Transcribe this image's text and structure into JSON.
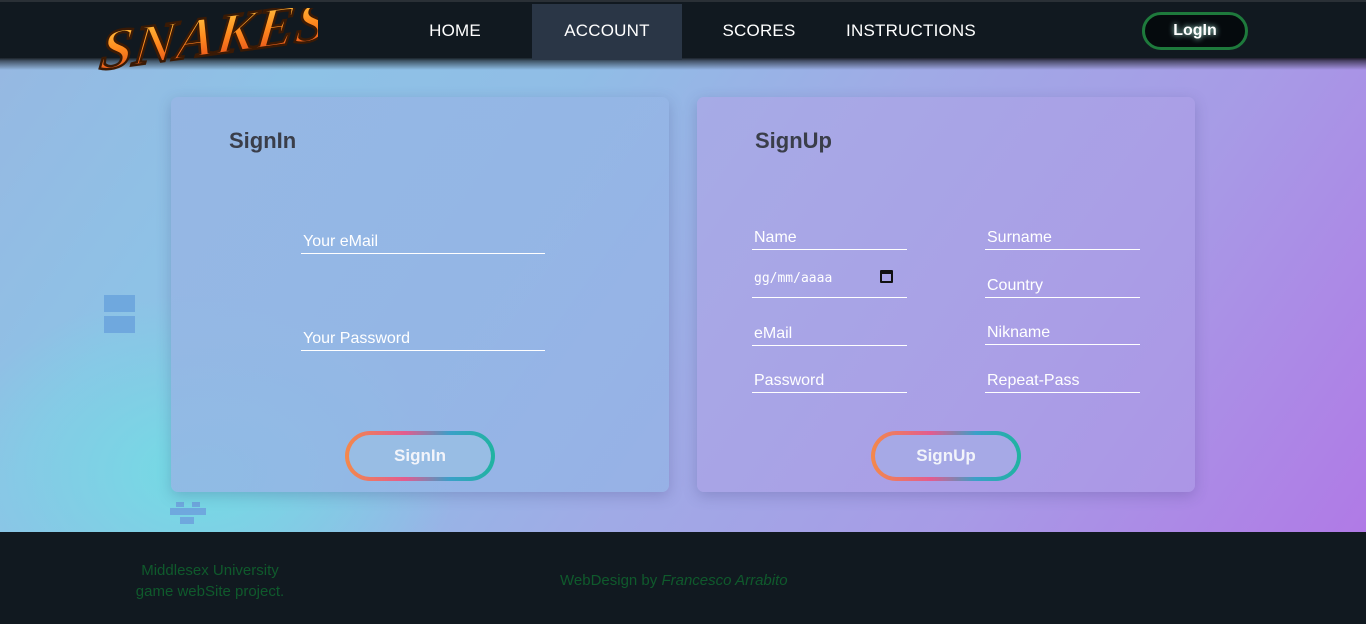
{
  "brand": {
    "logo_text": "SNAKES"
  },
  "nav": {
    "items": [
      {
        "label": "HOME",
        "active": false
      },
      {
        "label": "ACCOUNT",
        "active": true
      },
      {
        "label": "SCORES",
        "active": false
      },
      {
        "label": "INSTRUCTIONS",
        "active": false
      }
    ],
    "login_label": "LogIn"
  },
  "signin": {
    "title": "SignIn",
    "email_placeholder": "Your eMail",
    "password_placeholder": "Your Password",
    "button_label": "SignIn"
  },
  "signup": {
    "title": "SignUp",
    "name_placeholder": "Name",
    "surname_placeholder": "Surname",
    "date_placeholder": "gg/mm/aaaa",
    "country_placeholder": "Country",
    "email_placeholder": "eMail",
    "nickname_placeholder": "Nikname",
    "password_placeholder": "Password",
    "repeat_password_placeholder": "Repeat-Pass",
    "button_label": "SignUp"
  },
  "footer": {
    "left_line1": "Middlesex University",
    "left_line2": "game webSite project.",
    "credit_prefix": "WebDesign by",
    "credit_name": "Francesco Arrabito"
  },
  "colors": {
    "nav_bg": "#111920",
    "nav_active_bg": "#2a3646",
    "login_border": "#1e7a3c",
    "footer_text": "#0f5a2c",
    "button_gradient": [
      "#f4894a",
      "#e25c8f",
      "#3aa0c8",
      "#1fb4a0"
    ]
  },
  "icons": {
    "date_picker": "calendar-icon"
  }
}
